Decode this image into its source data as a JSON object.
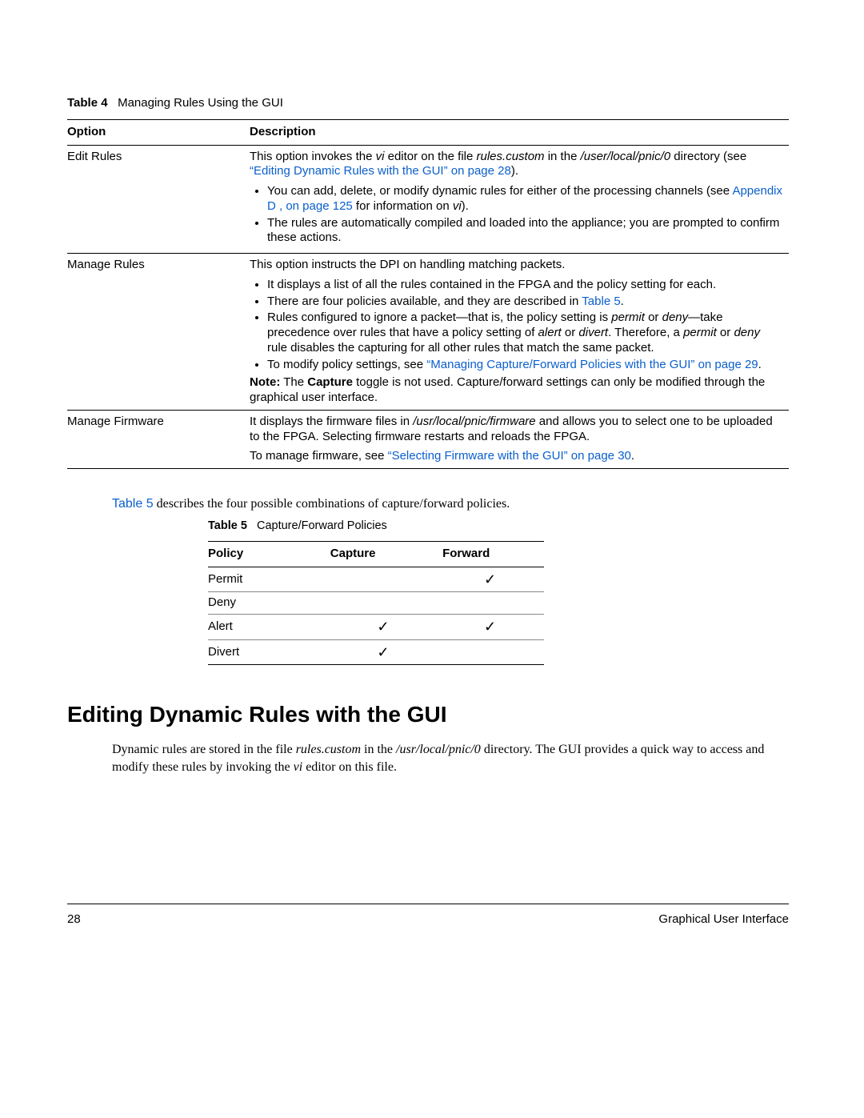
{
  "table4": {
    "caption_label": "Table 4",
    "caption_title": "Managing Rules Using the GUI",
    "head": {
      "option": "Option",
      "description": "Description"
    },
    "rows": {
      "edit": {
        "option": "Edit Rules",
        "desc_part1": "This option invokes the ",
        "desc_vi": "vi",
        "desc_part2": " editor on the file ",
        "desc_file": "rules.custom",
        "desc_part3": " in the ",
        "desc_dir": "/user/local/pnic/0",
        "desc_part4": " directory (see ",
        "desc_link": "“Editing Dynamic Rules with the GUI” on page 28",
        "desc_part5": ").",
        "b1_a": "You can add, delete, or modify dynamic rules for either of the processing channels (see ",
        "b1_link": "Appendix D , on page 125",
        "b1_b": " for information on ",
        "b1_vi": "vi",
        "b1_c": ").",
        "b2": "The rules are automatically compiled and loaded into the appliance; you are prompted to confirm these actions."
      },
      "manage": {
        "option": "Manage Rules",
        "desc": "This option instructs the DPI on handling matching packets.",
        "b1": "It displays a list of all the rules contained in the FPGA and the policy setting for each.",
        "b2_a": "There are four policies available, and they are described in ",
        "b2_link": "Table 5",
        "b2_b": ".",
        "b3_a": "Rules configured to ignore a packet—that is, the policy setting is ",
        "b3_permit": "permit",
        "b3_b": " or ",
        "b3_deny": "deny",
        "b3_c": "—take precedence over rules that have a policy setting of ",
        "b3_alert": "alert",
        "b3_d": " or ",
        "b3_divert": "divert",
        "b3_e": ". Therefore, a ",
        "b3_permit2": "permit",
        "b3_f": " or ",
        "b3_deny2": "deny",
        "b3_g": " rule disables the capturing for all other rules that match the same packet.",
        "b4_a": "To modify policy settings, see ",
        "b4_link": "“Managing Capture/Forward Policies with the GUI” on page 29",
        "b4_b": ".",
        "note_label": "Note:",
        "note_capture": "Capture",
        "note_text": " toggle is not used. Capture/forward settings can only be modified through the graphical user interface."
      },
      "firmware": {
        "option": "Manage Firmware",
        "p1_a": "It displays the firmware files in ",
        "p1_path": "/usr/local/pnic/firmware",
        "p1_b": " and allows you to select one to be uploaded to the FPGA. Selecting firmware restarts and reloads the FPGA.",
        "p2_a": "To manage firmware, see ",
        "p2_link": "“Selecting Firmware with the GUI” on page 30",
        "p2_b": "."
      }
    }
  },
  "mid_line": {
    "a": "Table 5",
    "b": " describes the four possible combinations of capture/forward policies."
  },
  "table5": {
    "caption_label": "Table 5",
    "caption_title": "Capture/Forward Policies",
    "head": {
      "policy": "Policy",
      "capture": "Capture",
      "forward": "Forward"
    },
    "rows": [
      {
        "policy": "Permit",
        "capture": "",
        "forward": "✓"
      },
      {
        "policy": "Deny",
        "capture": "",
        "forward": ""
      },
      {
        "policy": "Alert",
        "capture": "✓",
        "forward": "✓"
      },
      {
        "policy": "Divert",
        "capture": "✓",
        "forward": ""
      }
    ]
  },
  "heading": "Editing Dynamic Rules with the GUI",
  "body": {
    "a": "Dynamic rules are stored in the file ",
    "file": "rules.custom",
    "b": " in the ",
    "dir": "/usr/local/pnic/0",
    "c": " directory. The GUI provides a quick way to access and modify these rules by invoking the ",
    "vi": "vi",
    "d": " editor on this file."
  },
  "footer": {
    "page_num": "28",
    "section": "Graphical User Interface"
  },
  "chart_data": {
    "type": "table",
    "title": "Capture/Forward Policies",
    "columns": [
      "Policy",
      "Capture",
      "Forward"
    ],
    "rows": [
      [
        "Permit",
        false,
        true
      ],
      [
        "Deny",
        false,
        false
      ],
      [
        "Alert",
        true,
        true
      ],
      [
        "Divert",
        true,
        false
      ]
    ]
  }
}
